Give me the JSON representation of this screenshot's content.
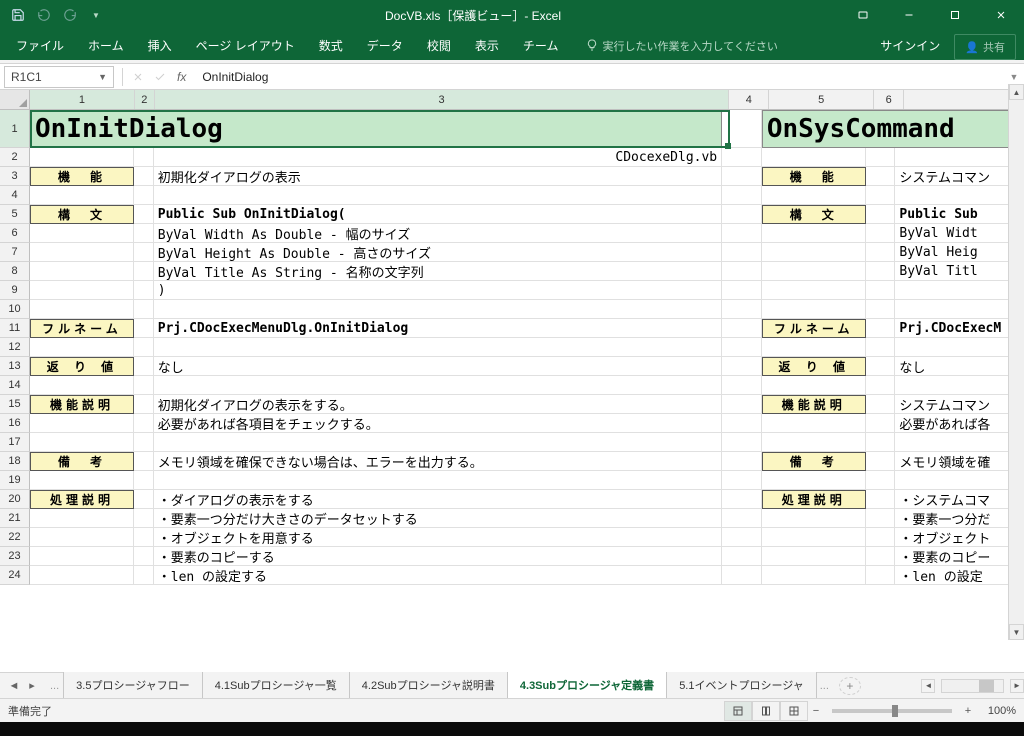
{
  "window": {
    "title": "DocVB.xls［保護ビュー］- Excel"
  },
  "ribbon": {
    "tabs": [
      "ファイル",
      "ホーム",
      "挿入",
      "ページ レイアウト",
      "数式",
      "データ",
      "校閲",
      "表示",
      "チーム"
    ],
    "tell_me": "実行したい作業を入力してください",
    "signin": "サインイン",
    "share": "共有"
  },
  "formula_bar": {
    "name_box": "R1C1",
    "formula": "OnInitDialog"
  },
  "columns": [
    "1",
    "2",
    "3",
    "4",
    "5",
    "6"
  ],
  "rows": [
    "1",
    "2",
    "3",
    "4",
    "5",
    "6",
    "7",
    "8",
    "9",
    "10",
    "11",
    "12",
    "13",
    "14",
    "15",
    "16",
    "17",
    "18",
    "19",
    "20",
    "21",
    "22",
    "23",
    "24"
  ],
  "left_block": {
    "title": "OnInitDialog",
    "source_file": "CDocexeDlg.vb",
    "labels": {
      "function": "機　能",
      "syntax": "構　文",
      "fullname": "フルネーム",
      "return": "返 り 値",
      "desc": "機能説明",
      "remarks": "備　考",
      "process": "処理説明"
    },
    "function": "初期化ダイアログの表示",
    "syntax_lines": [
      "Public Sub OnInitDialog(",
      "  ByVal Width   As Double - 幅のサイズ",
      "  ByVal Height  As Double - 高さのサイズ",
      "  ByVal Title   As String - 名称の文字列",
      ")"
    ],
    "fullname": "Prj.CDocExecMenuDlg.OnInitDialog",
    "return": "なし",
    "desc_lines": [
      "初期化ダイアログの表示をする。",
      "必要があれば各項目をチェックする。"
    ],
    "remarks": "メモリ領域を確保できない場合は、エラーを出力する。",
    "process_lines": [
      "・ダイアログの表示をする",
      "・要素一つ分だけ大きさのデータセットする",
      "・オブジェクトを用意する",
      "・要素のコピーする",
      "・len の設定する"
    ]
  },
  "right_block": {
    "title": "OnSysCommand",
    "labels": {
      "function": "機　能",
      "syntax": "構　文",
      "fullname": "フルネーム",
      "return": "返 り 値",
      "desc": "機能説明",
      "remarks": "備　考",
      "process": "処理説明"
    },
    "function": "システムコマン",
    "syntax_lines": [
      "Public Sub",
      "  ByVal Widt",
      "  ByVal Heig",
      "  ByVal Titl"
    ],
    "fullname": "Prj.CDocExecM",
    "return": "なし",
    "desc_lines": [
      "システムコマン",
      "必要があれば各"
    ],
    "remarks": "メモリ領域を確",
    "process_lines": [
      "・システムコマ",
      "・要素一つ分だ",
      "・オブジェクト",
      "・要素のコピー",
      "・len の設定"
    ]
  },
  "sheet_tabs": {
    "items": [
      "3.5プロシージャフロー",
      "4.1Subプロシージャ一覧",
      "4.2Subプロシージャ説明書",
      "4.3Subプロシージャ定義書",
      "5.1イベントプロシージャ"
    ],
    "active": 3,
    "ellipsis": "..."
  },
  "status_bar": {
    "left": "準備完了",
    "zoom": "100%"
  },
  "chart_data": {
    "type": "table",
    "title": "OnInitDialog procedure definition",
    "rows": [
      {
        "label": "機能",
        "value": "初期化ダイアログの表示"
      },
      {
        "label": "構文",
        "value": "Public Sub OnInitDialog( ByVal Width As Double - 幅のサイズ, ByVal Height As Double - 高さのサイズ, ByVal Title As String - 名称の文字列 )"
      },
      {
        "label": "フルネーム",
        "value": "Prj.CDocExecMenuDlg.OnInitDialog"
      },
      {
        "label": "返り値",
        "value": "なし"
      },
      {
        "label": "機能説明",
        "value": "初期化ダイアログの表示をする。必要があれば各項目をチェックする。"
      },
      {
        "label": "備考",
        "value": "メモリ領域を確保できない場合は、エラーを出力する。"
      },
      {
        "label": "処理説明",
        "value": "ダイアログの表示をする / 要素一つ分だけ大きさのデータセットする / オブジェクトを用意する / 要素のコピーする / len の設定する"
      }
    ]
  }
}
